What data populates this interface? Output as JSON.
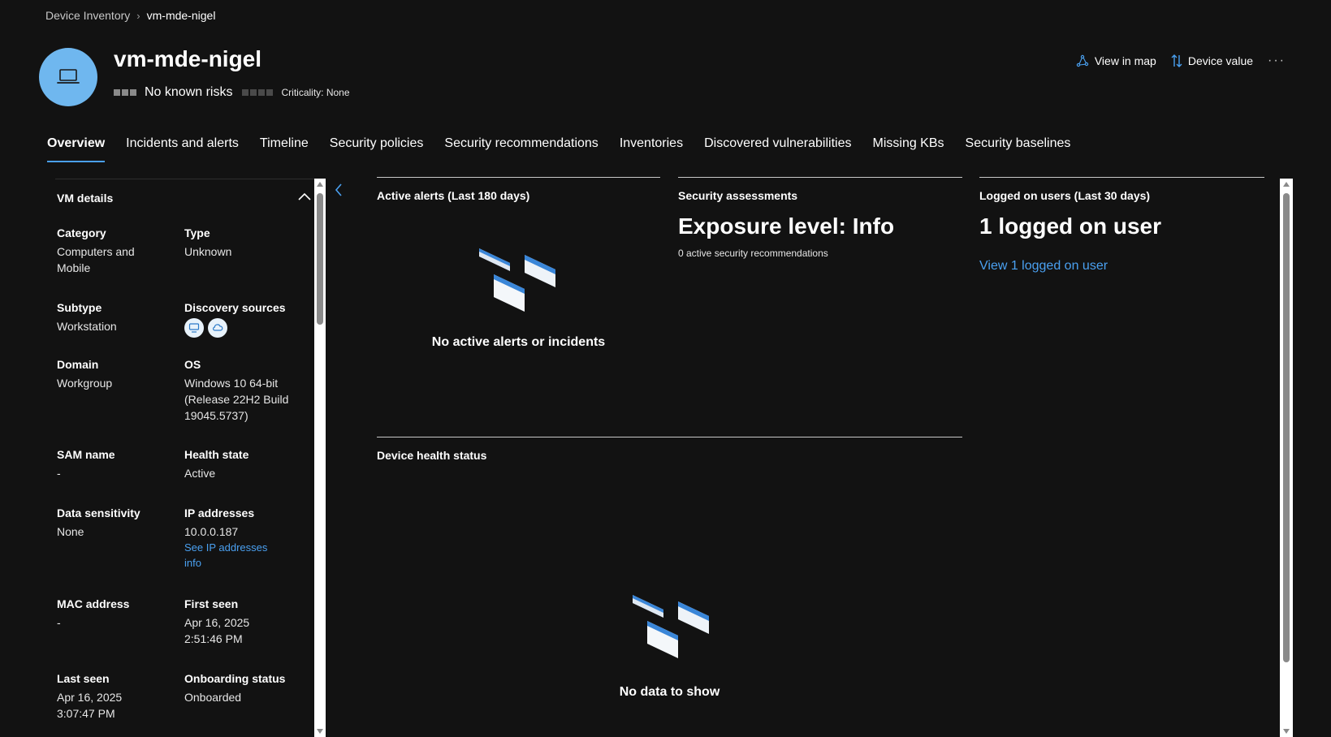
{
  "breadcrumb": {
    "parent": "Device Inventory",
    "current": "vm-mde-nigel"
  },
  "device": {
    "name": "vm-mde-nigel",
    "risk": "No known risks",
    "criticality": "Criticality: None",
    "icon": "laptop-icon"
  },
  "actions": {
    "view_in_map": "View in map",
    "device_value": "Device value",
    "more": "···"
  },
  "tabs": [
    {
      "label": "Overview",
      "active": true
    },
    {
      "label": "Incidents and alerts"
    },
    {
      "label": "Timeline"
    },
    {
      "label": "Security policies"
    },
    {
      "label": "Security recommendations"
    },
    {
      "label": "Inventories"
    },
    {
      "label": "Discovered vulnerabilities"
    },
    {
      "label": "Missing KBs"
    },
    {
      "label": "Security baselines"
    }
  ],
  "vm_details": {
    "title": "VM details",
    "category": {
      "label": "Category",
      "value": "Computers and Mobile"
    },
    "type": {
      "label": "Type",
      "value": "Unknown"
    },
    "subtype": {
      "label": "Subtype",
      "value": "Workstation"
    },
    "discovery_sources": {
      "label": "Discovery sources"
    },
    "domain": {
      "label": "Domain",
      "value": "Workgroup"
    },
    "os": {
      "label": "OS",
      "value": "Windows 10 64-bit (Release 22H2 Build 19045.5737)"
    },
    "sam_name": {
      "label": "SAM name",
      "value": "-"
    },
    "health_state": {
      "label": "Health state",
      "value": "Active"
    },
    "data_sensitivity": {
      "label": "Data sensitivity",
      "value": "None"
    },
    "ip_addresses": {
      "label": "IP addresses",
      "value": "10.0.0.187",
      "link": "See IP addresses info"
    },
    "mac_address": {
      "label": "MAC address",
      "value": "-"
    },
    "first_seen": {
      "label": "First seen",
      "date": "Apr 16, 2025",
      "time": "2:51:46 PM"
    },
    "last_seen": {
      "label": "Last seen",
      "date": "Apr 16, 2025",
      "time": "3:07:47 PM"
    },
    "onboarding": {
      "label": "Onboarding status",
      "value": "Onboarded"
    }
  },
  "cards": {
    "alerts": {
      "title": "Active alerts (Last 180 days)",
      "empty": "No active alerts or incidents"
    },
    "security": {
      "title": "Security assessments",
      "exposure": "Exposure level: Info",
      "recommendations": "0 active security recommendations"
    },
    "users": {
      "title": "Logged on users (Last 30 days)",
      "count": "1 logged on user",
      "link": "View 1 logged on user"
    },
    "health": {
      "title": "Device health status",
      "empty": "No data to show"
    }
  },
  "colors": {
    "accent": "#4aa0f0",
    "avatar": "#6fb7ef",
    "background": "#121212"
  }
}
